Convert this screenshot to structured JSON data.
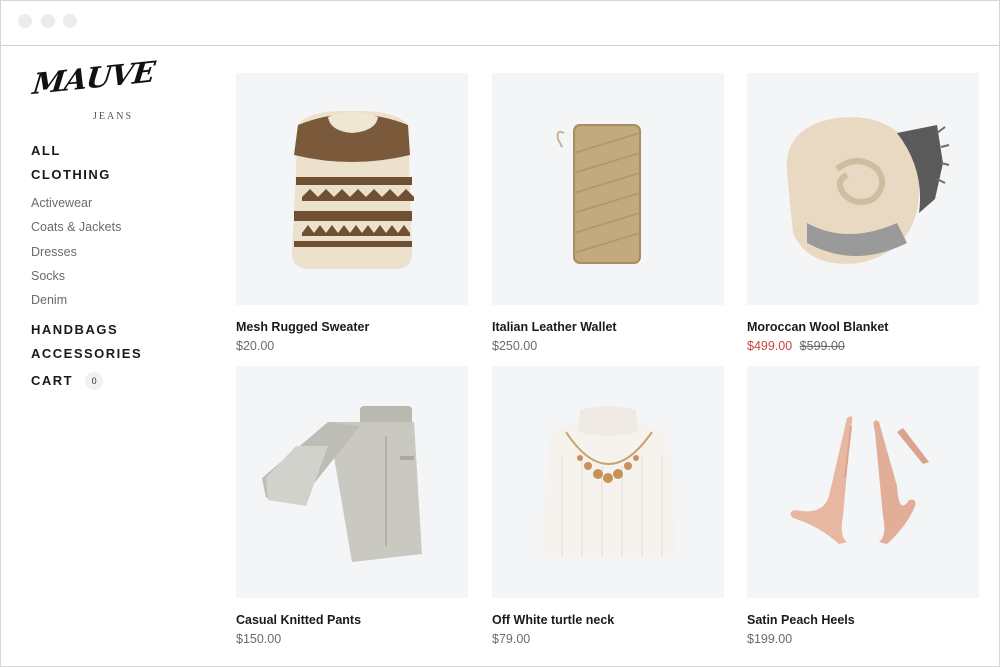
{
  "brand": {
    "logo_main": "MAUVE",
    "logo_sub": "JEANS"
  },
  "sidebar": {
    "all": "ALL",
    "clothing": "CLOTHING",
    "clothing_items": [
      "Activewear",
      "Coats & Jackets",
      "Dresses",
      "Socks",
      "Denim"
    ],
    "handbags": "HANDBAGS",
    "accessories": "ACCESSORIES",
    "cart": "CART",
    "cart_count": "0"
  },
  "products": [
    {
      "name": "Mesh Rugged Sweater",
      "price": "$20.00",
      "icon": "sweater-image"
    },
    {
      "name": "Italian Leather Wallet",
      "price": "$250.00",
      "icon": "wallet-image"
    },
    {
      "name": "Moroccan Wool Blanket",
      "price": "$499.00",
      "old_price": "$599.00",
      "icon": "blanket-image"
    },
    {
      "name": "Casual Knitted Pants",
      "price": "$150.00",
      "icon": "pants-image"
    },
    {
      "name": "Off White turtle neck",
      "price": "$79.00",
      "icon": "turtleneck-image"
    },
    {
      "name": "Satin Peach Heels",
      "price": "$199.00",
      "icon": "heels-image"
    }
  ],
  "colors": {
    "sale": "#c9473c",
    "card_bg": "#f4f5f7",
    "text": "#1a1a1a",
    "muted": "#6b6b6b"
  }
}
